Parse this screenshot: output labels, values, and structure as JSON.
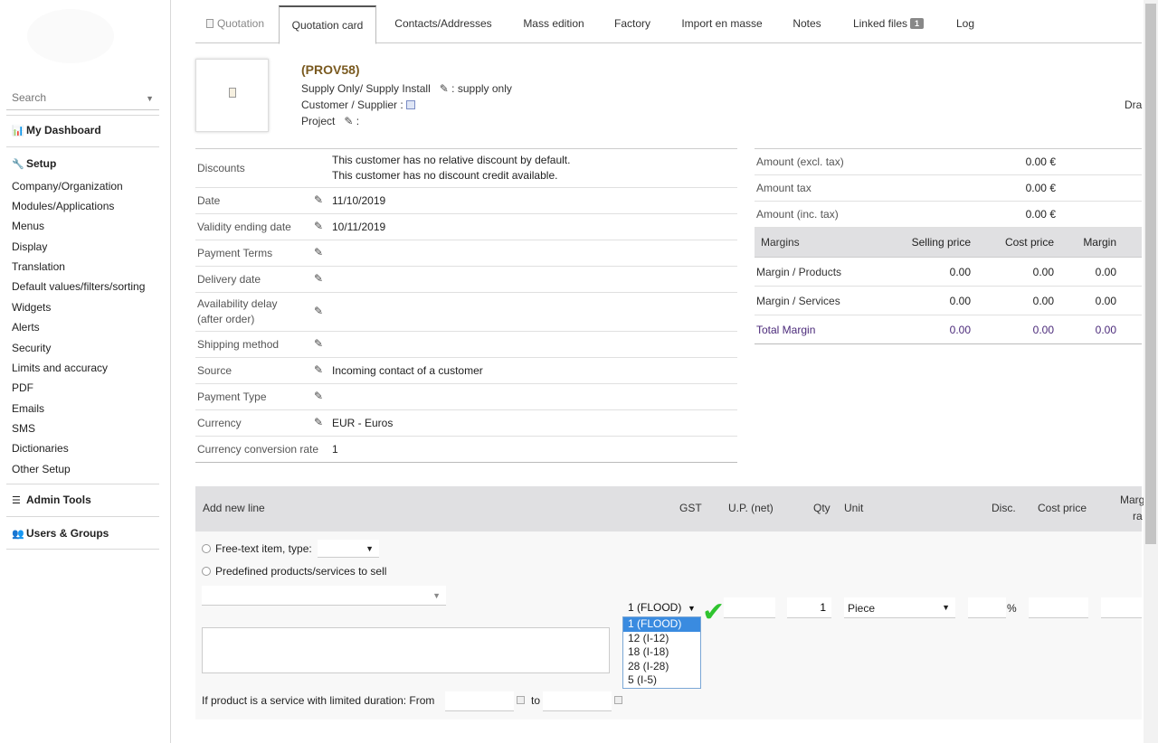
{
  "sidebar": {
    "search_placeholder": "Search",
    "dashboard": "My Dashboard",
    "setup": "Setup",
    "setup_items": [
      "Company/Organization",
      "Modules/Applications",
      "Menus",
      "Display",
      "Translation",
      "Default values/filters/sorting",
      "Widgets",
      "Alerts",
      "Security",
      "Limits and accuracy",
      "PDF",
      "Emails",
      "SMS",
      "Dictionaries",
      "Other Setup"
    ],
    "admin_tools": "Admin Tools",
    "users_groups": "Users & Groups"
  },
  "tabs": [
    {
      "label": "Quotation"
    },
    {
      "label": "Quotation card"
    },
    {
      "label": "Contacts/Addresses"
    },
    {
      "label": "Mass edition"
    },
    {
      "label": "Factory"
    },
    {
      "label": "Import en masse"
    },
    {
      "label": "Notes"
    },
    {
      "label": "Linked files",
      "badge": "1"
    },
    {
      "label": "Log"
    }
  ],
  "banner": {
    "ref": "(PROV58)",
    "line1_label": "Supply Only/ Supply Install",
    "line1_value": ": supply only",
    "line2_label": "Customer / Supplier :",
    "line3_label": "Project",
    "line3_value": ":",
    "status": "Dra"
  },
  "details": {
    "discounts_label": "Discounts",
    "discount_line1": "This customer has no relative discount by default.",
    "discount_line2": "This customer has no discount credit available.",
    "date_label": "Date",
    "date_value": "11/10/2019",
    "validity_label": "Validity ending date",
    "validity_value": "10/11/2019",
    "payment_terms_label": "Payment Terms",
    "delivery_date_label": "Delivery date",
    "availability_label_1": "Availability delay",
    "availability_label_2": "(after order)",
    "shipping_label": "Shipping method",
    "source_label": "Source",
    "source_value": "Incoming contact of a customer",
    "payment_type_label": "Payment Type",
    "currency_label": "Currency",
    "currency_value": "EUR - Euros",
    "conversion_label": "Currency conversion rate",
    "conversion_value": "1"
  },
  "amounts": {
    "excl_label": "Amount (excl. tax)",
    "excl_value": "0.00 €",
    "tax_label": "Amount tax",
    "tax_value": "0.00 €",
    "inc_label": "Amount (inc. tax)",
    "inc_value": "0.00 €"
  },
  "margins": {
    "headers": [
      "Margins",
      "Selling price",
      "Cost price",
      "Margin"
    ],
    "rows": [
      [
        "Margin / Products",
        "0.00",
        "0.00",
        "0.00"
      ],
      [
        "Margin / Services",
        "0.00",
        "0.00",
        "0.00"
      ],
      [
        "Total Margin",
        "0.00",
        "0.00",
        "0.00"
      ]
    ]
  },
  "addline": {
    "headers": {
      "title": "Add new line",
      "gst": "GST",
      "up": "U.P. (net)",
      "qty": "Qty",
      "unit": "Unit",
      "disc": "Disc.",
      "cost": "Cost price",
      "marg": "Marg",
      "marg2": "ra"
    },
    "free_text": "Free-text item, type:",
    "predefined": "Predefined products/services to sell",
    "qty_value": "1",
    "unit_value": "Piece",
    "disc_suffix": "%",
    "gst_selected": "1 (FLOOD)",
    "gst_options": [
      "1 (FLOOD)",
      "12 (I-12)",
      "18 (I-18)",
      "28 (I-28)",
      "5 (I-5)"
    ],
    "service_label": "If product is a service with limited duration: From",
    "to_label": "to"
  }
}
